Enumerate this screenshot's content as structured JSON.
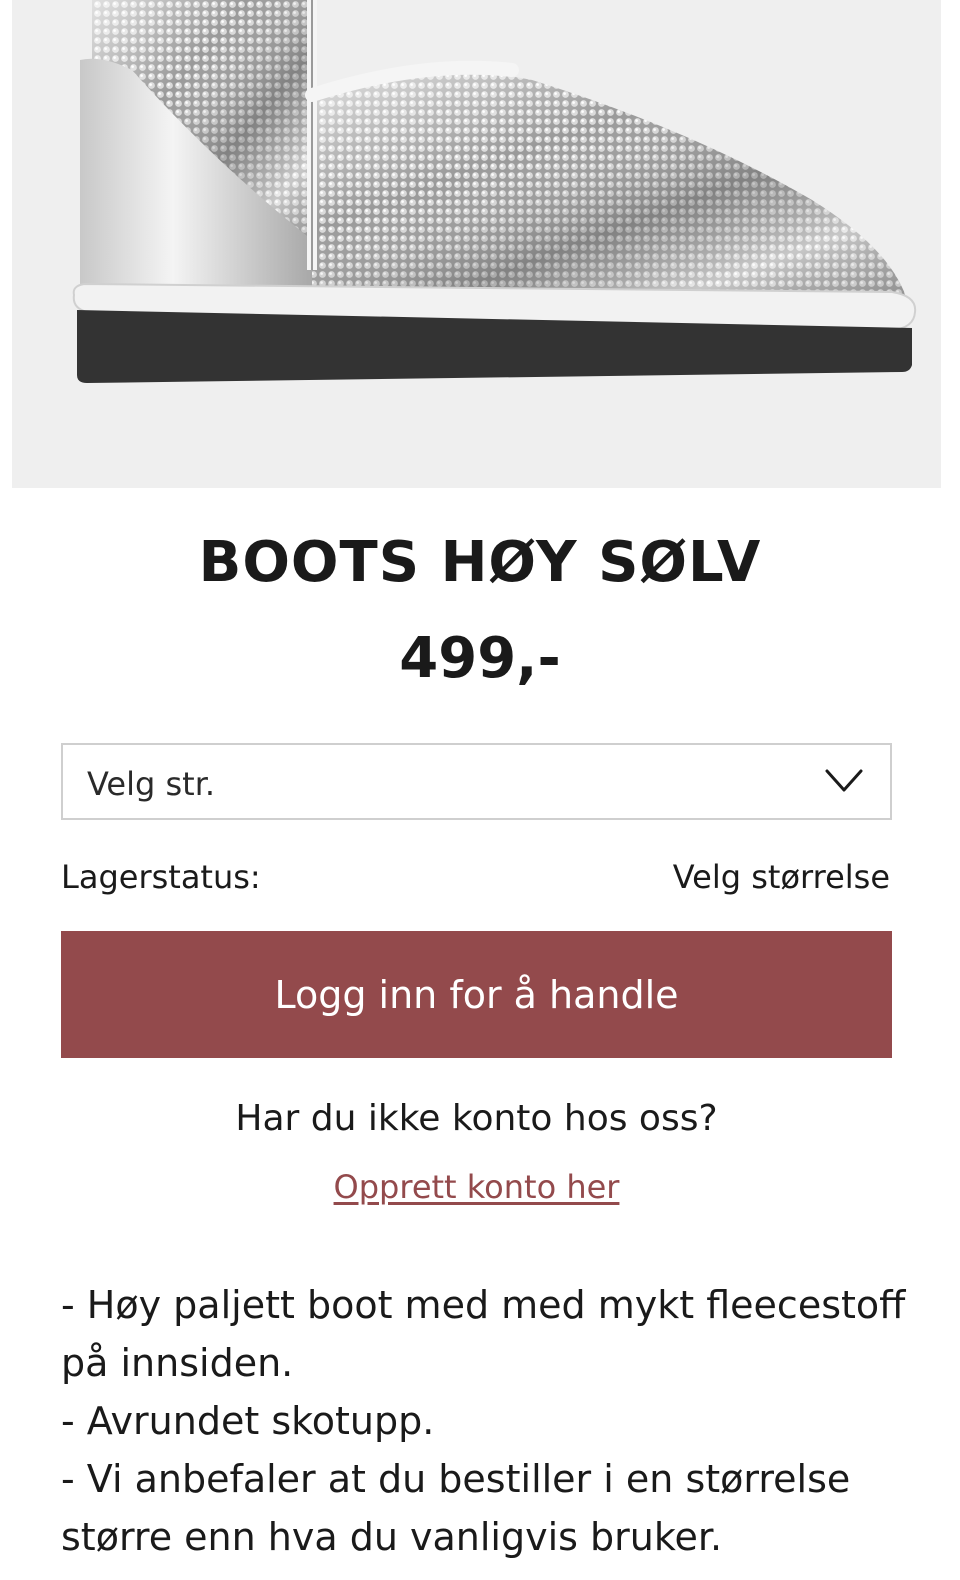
{
  "product": {
    "image_alt": "Sølv paljett boot",
    "title": "BOOTS HØY SØLV",
    "price": "499,-"
  },
  "size_select": {
    "placeholder": "Velg str."
  },
  "stock": {
    "label": "Lagerstatus:",
    "value": "Velg størrelse"
  },
  "login_button": "Logg inn for å handle",
  "account": {
    "question": "Har du ikke konto hos oss?",
    "create_link": "Opprett konto her"
  },
  "description": [
    "- Høy paljett boot med med mykt fleecestoff på innsiden.",
    "- Avrundet skotupp.",
    "- Vi anbefaler at du bestiller i en størrelse større enn hva du vanligvis bruker."
  ],
  "colors": {
    "accent": "#934a4c",
    "image_background": "#efefef",
    "sole": "#333333",
    "text": "#1a1a1a"
  },
  "icons": {
    "dropdown": "chevron-down-icon"
  }
}
